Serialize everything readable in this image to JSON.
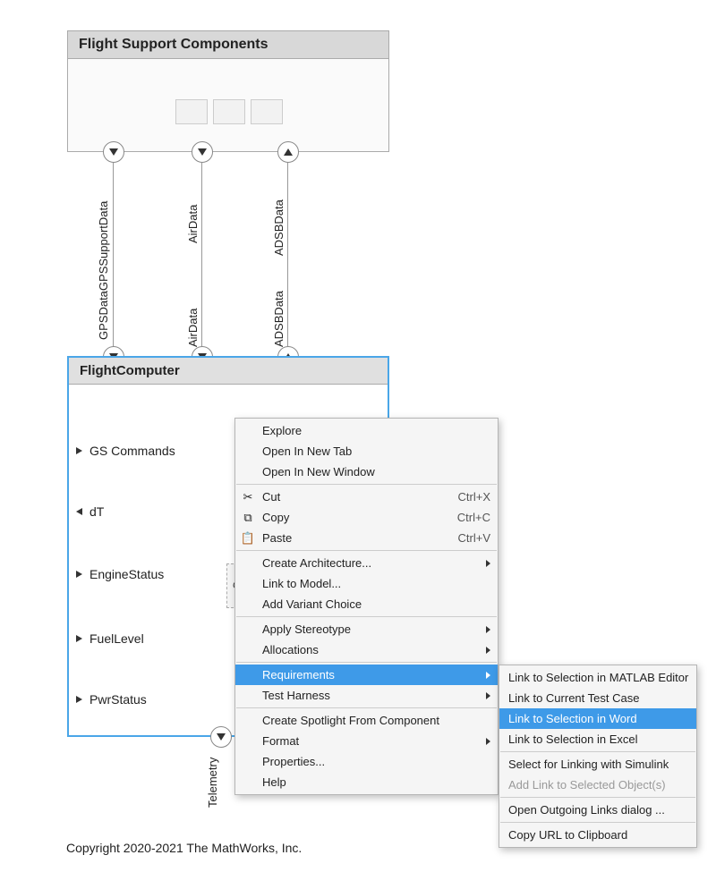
{
  "blocks": {
    "support": {
      "title": "Flight Support Components"
    },
    "computer": {
      "title": "FlightComputer"
    }
  },
  "signals": {
    "s1": {
      "top": "GPSDataGPSSupportData",
      "bottom": ""
    },
    "s2": {
      "top": "AirData",
      "bottom": "AirData"
    },
    "s3": {
      "top": "ADSBData",
      "bottom": "ADSBData"
    }
  },
  "ports": {
    "p1": "GS Commands",
    "p2": "dT",
    "p3": "EngineStatus",
    "p4": "FuelLevel",
    "p5": "PwrStatus",
    "bottom": "Telemetry"
  },
  "inner_chip": "Co",
  "context_menu": {
    "explore": "Explore",
    "open_tab": "Open In New Tab",
    "open_win": "Open In New Window",
    "cut": "Cut",
    "copy": "Copy",
    "paste": "Paste",
    "cut_key": "Ctrl+X",
    "copy_key": "Ctrl+C",
    "paste_key": "Ctrl+V",
    "create_arch": "Create Architecture...",
    "link_model": "Link to Model...",
    "add_variant": "Add Variant Choice",
    "apply_stereo": "Apply Stereotype",
    "allocations": "Allocations",
    "requirements": "Requirements",
    "test_harness": "Test Harness",
    "spotlight": "Create Spotlight From Component",
    "format": "Format",
    "properties": "Properties...",
    "help": "Help"
  },
  "submenu": {
    "matlab": "Link to Selection in MATLAB Editor",
    "testcase": "Link to Current Test Case",
    "word": "Link to Selection in Word",
    "excel": "Link to Selection in Excel",
    "simulink": "Select for Linking with Simulink",
    "addlink": "Add Link to Selected Object(s)",
    "outgoing": "Open Outgoing Links dialog ...",
    "copyurl": "Copy URL to Clipboard"
  },
  "copyright": "Copyright 2020-2021 The MathWorks, Inc."
}
